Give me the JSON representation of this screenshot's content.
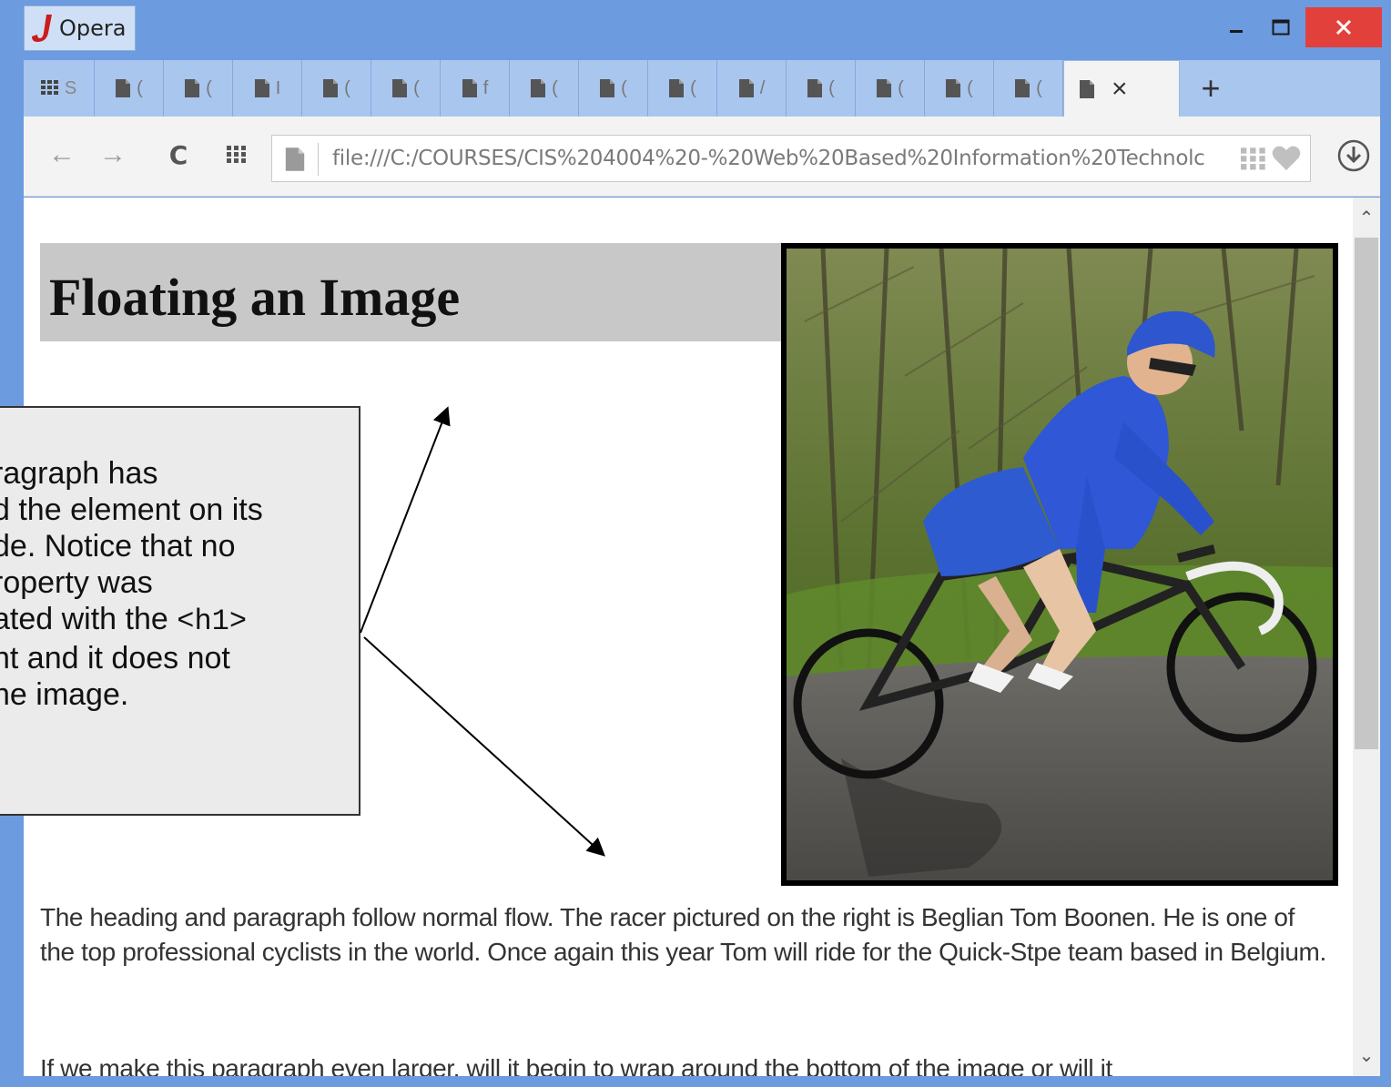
{
  "window": {
    "app_name": "Opera",
    "minimize_glyph": "‗",
    "maximize_glyph": "☐",
    "close_glyph": "✕"
  },
  "tabs": {
    "items": [
      {
        "label": "S",
        "icon": "speed-dial-icon"
      },
      {
        "label": "(",
        "icon": "page-icon"
      },
      {
        "label": "(",
        "icon": "page-icon"
      },
      {
        "label": "I",
        "icon": "page-icon"
      },
      {
        "label": "(",
        "icon": "page-icon"
      },
      {
        "label": "(",
        "icon": "page-icon"
      },
      {
        "label": "f",
        "icon": "page-icon"
      },
      {
        "label": "(",
        "icon": "page-icon"
      },
      {
        "label": "(",
        "icon": "page-icon"
      },
      {
        "label": "(",
        "icon": "page-icon"
      },
      {
        "label": "/",
        "icon": "page-icon"
      },
      {
        "label": "(",
        "icon": "page-icon"
      },
      {
        "label": "(",
        "icon": "page-icon"
      },
      {
        "label": "(",
        "icon": "page-icon"
      },
      {
        "label": "(",
        "icon": "page-icon"
      }
    ],
    "active_close": "×",
    "new_tab": "+"
  },
  "navigation": {
    "back": "←",
    "forward": "→",
    "reload": "C",
    "url": "file:///C:/COURSES/CIS%204004%20-%20Web%20Based%20Information%20Technolc"
  },
  "page": {
    "heading": "Floating an Image",
    "paragraph1": "The heading and paragraph follow normal flow. The racer pictured on the right is Beglian Tom Boonen. He is one of the top professional cyclists in the world. Once again this year Tom will ride for the Quick-Stpe team based in Belgium.",
    "paragraph2": "If we make this paragraph even larger, will it begin to wrap around the bottom of the image or will it"
  },
  "callout": {
    "line1": "ragraph has",
    "line2": "d the element on its",
    "line3": "de.  Notice that no",
    "line4": "roperty was",
    "line5_prefix": "ated with the ",
    "line5_code": "<h1>",
    "line6": "nt and it does not",
    "line7": "he image."
  },
  "colors": {
    "window_chrome": "#6c9be0",
    "close_button": "#e2403a",
    "heading_background": "#c8c8c8"
  }
}
